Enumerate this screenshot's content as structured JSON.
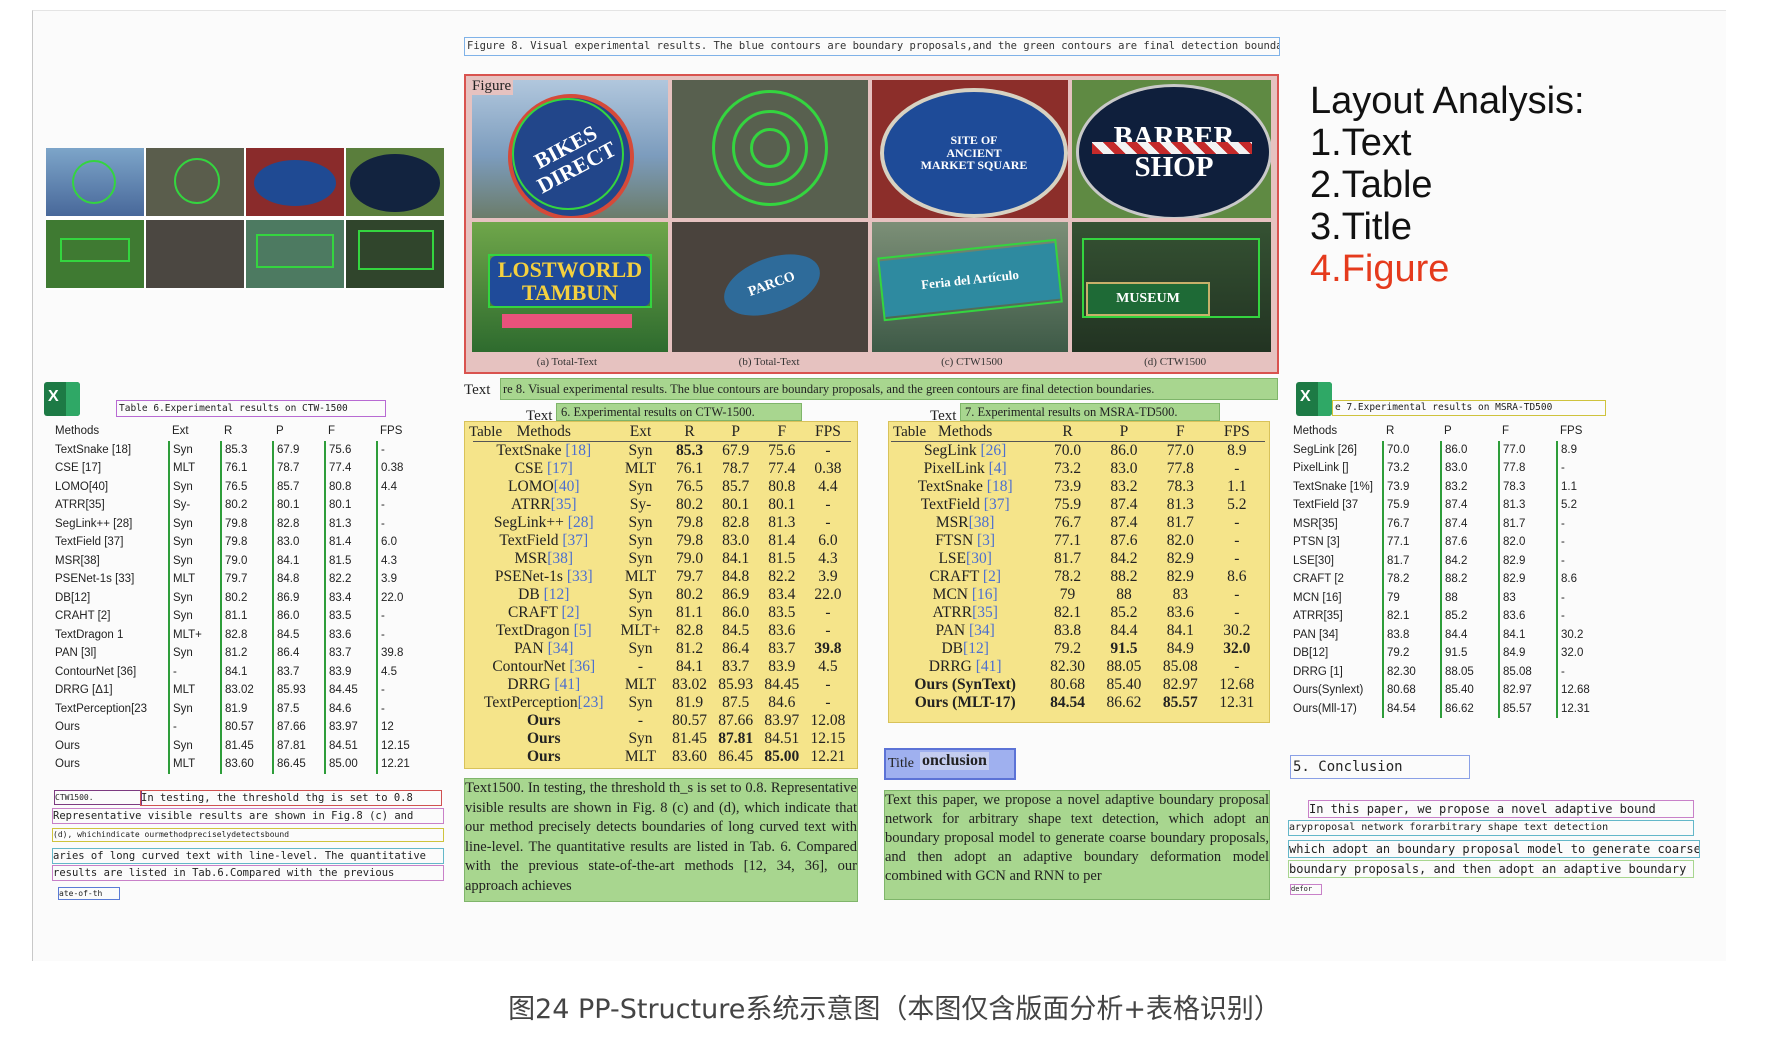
{
  "figure_caption": "Figure 8. Visual experimental results. The blue contours are boundary proposals,and the green contours are final detection boundaries.",
  "figure_label": "Figure",
  "figure_captions_sub": [
    "(a) Total-Text",
    "(b) Total-Text",
    "(c) CTW1500",
    "(d) CTW1500"
  ],
  "signs": {
    "bikes": "BIKES\nDIRECT",
    "heritage": "SITE OF\nANCIENT\nMARKET SQUARE",
    "barber": "BARBER\nSHOP",
    "lostworld": "LOSTWORLD\nTAMBUN",
    "parco": "PARCO",
    "peria": "Feria del Artículo",
    "muse": "MUSEUM"
  },
  "text_label": "Text",
  "title_label": "Title",
  "text_green_caption": "re 8. Visual experimental results. The blue contours are boundary proposals, and the green contours are final detection boundaries.",
  "layout_analysis": {
    "heading": "Layout Analysis:",
    "items": [
      "1.Text",
      "2.Table",
      "3.Title",
      "4.Figure"
    ],
    "highlight_color": "#e53a1c"
  },
  "left_table": {
    "caption": "Table 6.Experimental results on CTW-1500",
    "rows": [
      [
        "Methods",
        "Ext",
        "R",
        "P",
        "F",
        "FPS"
      ],
      [
        "TextSnake [18]",
        "Syn",
        "85.3",
        "67.9",
        "75.6",
        "-"
      ],
      [
        "CSE [17]",
        "MLT",
        "76.1",
        "78.7",
        "77.4",
        "0.38"
      ],
      [
        "LOMO[40]",
        "Syn",
        "76.5",
        "85.7",
        "80.8",
        "4.4"
      ],
      [
        "ATRR[35]",
        "Sy-",
        "80.2",
        "80.1",
        "80.1",
        "-"
      ],
      [
        "SegLink++ [28]",
        "Syn",
        "79.8",
        "82.8",
        "81.3",
        "-"
      ],
      [
        "TextField [37]",
        "Syn",
        "79.8",
        "83.0",
        "81.4",
        "6.0"
      ],
      [
        "MSR[38]",
        "Syn",
        "79.0",
        "84.1",
        "81.5",
        "4.3"
      ],
      [
        "PSENet-1s [33]",
        "MLT",
        "79.7",
        "84.8",
        "82.2",
        "3.9"
      ],
      [
        "DB[12]",
        "Syn",
        "80.2",
        "86.9",
        "83.4",
        "22.0"
      ],
      [
        "CRAHT [2]",
        "Syn",
        "81.1",
        "86.0",
        "83.5",
        "-"
      ],
      [
        "TextDragon 1",
        "MLT+",
        "82.8",
        "84.5",
        "83.6",
        "-"
      ],
      [
        "PAN [3l]",
        "Syn",
        "81.2",
        "86.4",
        "83.7",
        "39.8"
      ],
      [
        "ContourNet [36]",
        "-",
        "84.1",
        "83.7",
        "83.9",
        "4.5"
      ],
      [
        "DRRG [Δ1]",
        "MLT",
        "83.02",
        "85.93",
        "84.45",
        "-"
      ],
      [
        "TextPerception[23",
        "Syn",
        "81.9",
        "87.5",
        "84.6",
        "-"
      ],
      [
        "Ours",
        "-",
        "80.57",
        "87.66",
        "83.97",
        "12"
      ],
      [
        "Ours",
        "Syn",
        "81.45",
        "87.81",
        "84.51",
        "12.15"
      ],
      [
        "Ours",
        "MLT",
        "83.60",
        "86.45",
        "85.00",
        "12.21"
      ]
    ],
    "text_lines": [
      "CTW1500.",
      "In testing, the threshold thg is set to 0.8",
      "Representative visible results are shown in Fig.8 (c) and",
      "(d), whichindicate ourmethodpreciselydetectsbound",
      "aries of long curved text with line-level. The quantitative",
      "results are listed in Tab.6.Compared with the previous",
      "ate-of-th"
    ]
  },
  "mid_table": {
    "caption": "6. Experimental results on CTW-1500.",
    "label": "Text",
    "table_label": "Table",
    "rows": [
      [
        "Methods",
        "Ext",
        "R",
        "P",
        "F",
        "FPS"
      ],
      [
        "TextSnake [18]",
        "Syn",
        "85.3",
        "67.9",
        "75.6",
        "-"
      ],
      [
        "CSE [17]",
        "MLT",
        "76.1",
        "78.7",
        "77.4",
        "0.38"
      ],
      [
        "LOMO[40]",
        "Syn",
        "76.5",
        "85.7",
        "80.8",
        "4.4"
      ],
      [
        "ATRR[35]",
        "Sy-",
        "80.2",
        "80.1",
        "80.1",
        "-"
      ],
      [
        "SegLink++ [28]",
        "Syn",
        "79.8",
        "82.8",
        "81.3",
        "-"
      ],
      [
        "TextField [37]",
        "Syn",
        "79.8",
        "83.0",
        "81.4",
        "6.0"
      ],
      [
        "MSR[38]",
        "Syn",
        "79.0",
        "84.1",
        "81.5",
        "4.3"
      ],
      [
        "PSENet-1s [33]",
        "MLT",
        "79.7",
        "84.8",
        "82.2",
        "3.9"
      ],
      [
        "DB [12]",
        "Syn",
        "80.2",
        "86.9",
        "83.4",
        "22.0"
      ],
      [
        "CRAFT [2]",
        "Syn",
        "81.1",
        "86.0",
        "83.5",
        "-"
      ],
      [
        "TextDragon [5]",
        "MLT+",
        "82.8",
        "84.5",
        "83.6",
        "-"
      ],
      [
        "PAN [34]",
        "Syn",
        "81.2",
        "86.4",
        "83.7",
        "39.8"
      ],
      [
        "ContourNet [36]",
        "-",
        "84.1",
        "83.7",
        "83.9",
        "4.5"
      ],
      [
        "DRRG [41]",
        "MLT",
        "83.02",
        "85.93",
        "84.45",
        "-"
      ],
      [
        "TextPerception[23]",
        "Syn",
        "81.9",
        "87.5",
        "84.6",
        "-"
      ],
      [
        "Ours",
        "-",
        "80.57",
        "87.66",
        "83.97",
        "12.08"
      ],
      [
        "Ours",
        "Syn",
        "81.45",
        "87.81",
        "84.51",
        "12.15"
      ],
      [
        "Ours",
        "MLT",
        "83.60",
        "86.45",
        "85.00",
        "12.21"
      ]
    ],
    "text_label": "Text",
    "text": "1500. In testing, the threshold th_s is set to 0.8. Representative visible results are shown in Fig. 8 (c) and (d), which indicate that our method precisely detects boundaries of long curved text with line-level. The quantitative results are listed in Tab. 6. Compared with the previous state-of-the-art methods [12, 34, 36], our approach achieves"
  },
  "right_table": {
    "caption": "7. Experimental results on MSRA-TD500.",
    "label": "Text",
    "table_label": "Table",
    "rows": [
      [
        "Methods",
        "R",
        "P",
        "F",
        "FPS"
      ],
      [
        "SegLink [26]",
        "70.0",
        "86.0",
        "77.0",
        "8.9"
      ],
      [
        "PixelLink [4]",
        "73.2",
        "83.0",
        "77.8",
        "-"
      ],
      [
        "TextSnake [18]",
        "73.9",
        "83.2",
        "78.3",
        "1.1"
      ],
      [
        "TextField [37]",
        "75.9",
        "87.4",
        "81.3",
        "5.2"
      ],
      [
        "MSR[38]",
        "76.7",
        "87.4",
        "81.7",
        "-"
      ],
      [
        "FTSN [3]",
        "77.1",
        "87.6",
        "82.0",
        "-"
      ],
      [
        "LSE[30]",
        "81.7",
        "84.2",
        "82.9",
        "-"
      ],
      [
        "CRAFT [2]",
        "78.2",
        "88.2",
        "82.9",
        "8.6"
      ],
      [
        "MCN [16]",
        "79",
        "88",
        "83",
        "-"
      ],
      [
        "ATRR[35]",
        "82.1",
        "85.2",
        "83.6",
        "-"
      ],
      [
        "PAN [34]",
        "83.8",
        "84.4",
        "84.1",
        "30.2"
      ],
      [
        "DB[12]",
        "79.2",
        "91.5",
        "84.9",
        "32.0"
      ],
      [
        "DRRG [41]",
        "82.30",
        "88.05",
        "85.08",
        "-"
      ],
      [
        "Ours (SynText)",
        "80.68",
        "85.40",
        "82.97",
        "12.68"
      ],
      [
        "Ours (MLT-17)",
        "84.54",
        "86.62",
        "85.57",
        "12.31"
      ]
    ],
    "title_text": "onclusion",
    "text_label": "Text",
    "text": "this paper, we propose a novel adaptive boundary proposal network for arbitrary shape text detection, which adopt an boundary proposal model to generate coarse boundary proposals, and then adopt an adaptive boundary deformation model combined with GCN and RNN to per"
  },
  "far_right": {
    "caption": "e 7.Experimental results on MSRA-TD500",
    "rows": [
      [
        "Methods",
        "R",
        "P",
        "F",
        "FPS"
      ],
      [
        "SegLink [26]",
        "70.0",
        "86.0",
        "77.0",
        "8.9"
      ],
      [
        "PixelLink []",
        "73.2",
        "83.0",
        "77.8",
        "-"
      ],
      [
        "TextSnake [1%]",
        "73.9",
        "83.2",
        "78.3",
        "1.1"
      ],
      [
        "TextField [37",
        "75.9",
        "87.4",
        "81.3",
        "5.2"
      ],
      [
        "MSR[35]",
        "76.7",
        "87.4",
        "81.7",
        "-"
      ],
      [
        "PTSN [3]",
        "77.1",
        "87.6",
        "82.0",
        "-"
      ],
      [
        "LSE[30]",
        "81.7",
        "84.2",
        "82.9",
        "-"
      ],
      [
        "CRAFT [2",
        "78.2",
        "88.2",
        "82.9",
        "8.6"
      ],
      [
        "MCN [16]",
        "79",
        "88",
        "83",
        "-"
      ],
      [
        "ATRR[35]",
        "82.1",
        "85.2",
        "83.6",
        "-"
      ],
      [
        "PAN [34]",
        "83.8",
        "84.4",
        "84.1",
        "30.2"
      ],
      [
        "DB[12]",
        "79.2",
        "91.5",
        "84.9",
        "32.0"
      ],
      [
        "DRRG [1]",
        "82.30",
        "88.05",
        "85.08",
        "-"
      ],
      [
        "Ours(Synlext)",
        "80.68",
        "85.40",
        "82.97",
        "12.68"
      ],
      [
        "Ours(Mll-17)",
        "84.54",
        "86.62",
        "85.57",
        "12.31"
      ]
    ],
    "title": "5. Conclusion",
    "text_lines": [
      "In this paper, we propose a novel adaptive bound",
      "aryproposal network forarbitrary shape text detection",
      "which adopt an boundary proposal model to generate coarse",
      "boundary proposals, and then adopt an adaptive boundary",
      "defor"
    ]
  },
  "page_caption": "图24 PP-Structure系统示意图（本图仅含版面分析+表格识别）",
  "colors": {
    "figure_box": "#d9534f",
    "table_box": "#f5e48a",
    "text_box": "#a8d68f",
    "title_box": "#9fb0ef",
    "ref_blue": "#4c6fd0"
  }
}
